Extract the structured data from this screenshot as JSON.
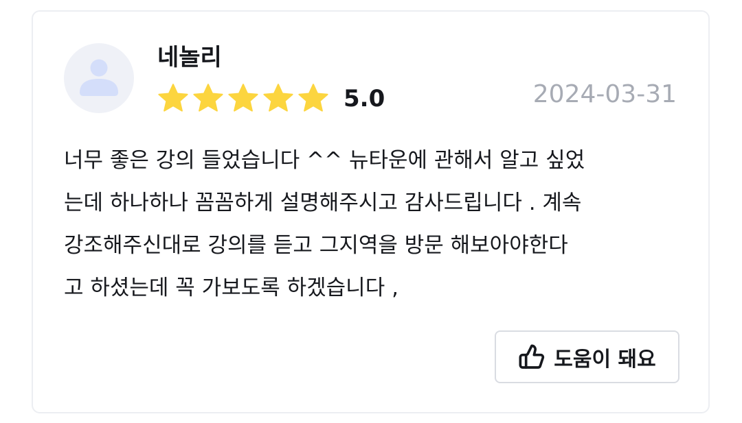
{
  "review": {
    "author": "네놀리",
    "rating": "5.0",
    "stars_filled": 5,
    "stars_total": 5,
    "date": "2024-03-31",
    "content_lines": [
      "너무 좋은 강의 들었습니다 ^^ 뉴타운에 관해서 알고 싶었",
      "는데 하나하나 꼼꼼하게 설명해주시고 감사드립니다 . 계속",
      "강조해주신대로 강의를 듣고 그지역을 방문 해보아야한다",
      "고 하셨는데 꼭 가보도록 하겠습니다 ,"
    ],
    "helpful_label": "도움이 돼요"
  },
  "icons": {
    "avatar": "user-avatar-icon",
    "star": "star-icon",
    "helpful": "thumbs-up-icon"
  },
  "colors": {
    "star": "#fcd53f",
    "date": "#a7abb4",
    "text": "#16181d",
    "avatar_bg": "#eff1f7",
    "avatar_figure": "#d4defa",
    "card_border": "#eceef2",
    "button_border": "#d9dce2"
  }
}
